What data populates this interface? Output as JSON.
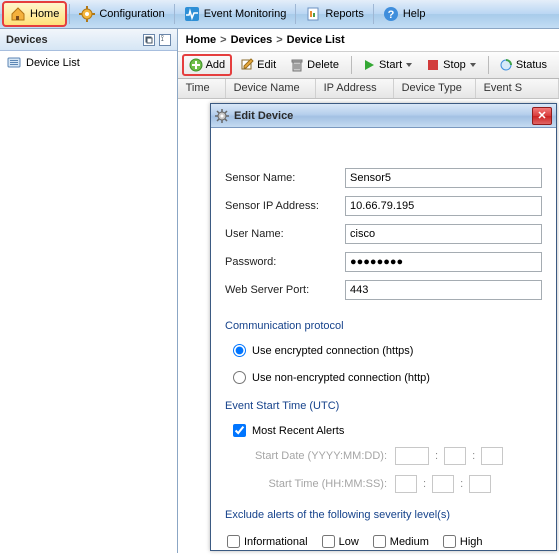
{
  "menu": {
    "home": "Home",
    "configuration": "Configuration",
    "event_monitoring": "Event Monitoring",
    "reports": "Reports",
    "help": "Help"
  },
  "left_panel": {
    "title": "Devices",
    "tree": {
      "device_list": "Device List"
    }
  },
  "breadcrumb": [
    "Home",
    "Devices",
    "Device List"
  ],
  "toolbar": {
    "add": "Add",
    "edit": "Edit",
    "delete": "Delete",
    "start": "Start",
    "stop": "Stop",
    "status": "Status"
  },
  "columns": [
    "Time",
    "Device Name",
    "IP Address",
    "Device Type",
    "Event S"
  ],
  "dialog": {
    "title": "Edit Device",
    "labels": {
      "sensor_name": "Sensor Name:",
      "sensor_ip": "Sensor IP Address:",
      "user_name": "User Name:",
      "password": "Password:",
      "web_port": "Web Server Port:"
    },
    "values": {
      "sensor_name": "Sensor5",
      "sensor_ip": "10.66.79.195",
      "user_name": "cisco",
      "password": "●●●●●●●●",
      "web_port": "443"
    },
    "sections": {
      "comm": "Communication protocol",
      "event_time": "Event Start Time (UTC)",
      "exclude": "Exclude alerts of the following severity level(s)"
    },
    "radios": {
      "https": "Use encrypted connection (https)",
      "http": "Use non-encrypted connection (http)"
    },
    "checks": {
      "most_recent": "Most Recent Alerts"
    },
    "time_labels": {
      "start_date": "Start Date (YYYY:MM:DD):",
      "start_time": "Start Time (HH:MM:SS):"
    },
    "severity": {
      "informational": "Informational",
      "low": "Low",
      "medium": "Medium",
      "high": "High"
    }
  }
}
